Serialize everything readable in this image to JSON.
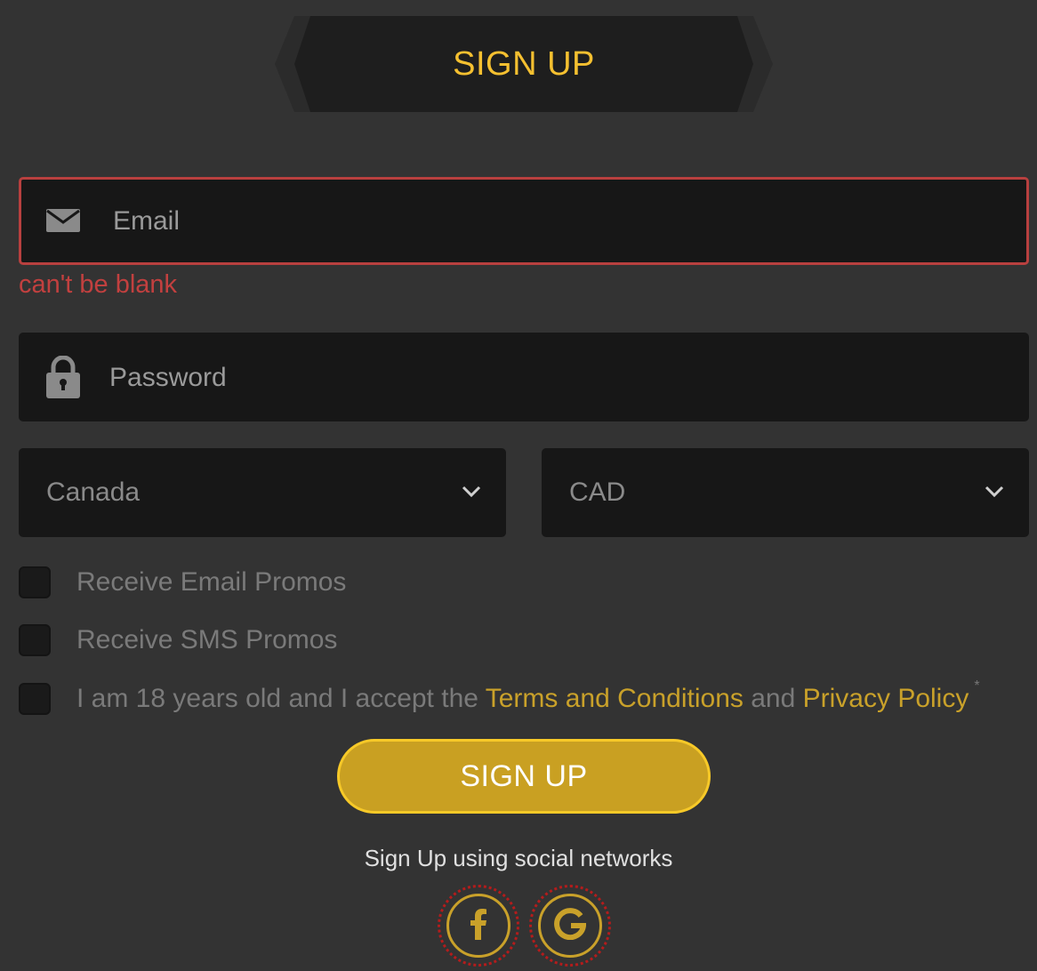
{
  "header": {
    "title": "SIGN UP"
  },
  "form": {
    "email": {
      "placeholder": "Email",
      "value": "",
      "icon": "envelope-icon",
      "error": "can't be blank"
    },
    "password": {
      "placeholder": "Password",
      "value": "",
      "icon": "lock-icon"
    },
    "country": {
      "selected": "Canada"
    },
    "currency": {
      "selected": "CAD"
    },
    "checkboxes": {
      "email_promos": {
        "label": "Receive Email Promos",
        "checked": false
      },
      "sms_promos": {
        "label": "Receive SMS Promos",
        "checked": false
      },
      "terms": {
        "prefix": "I am 18 years old and I accept the",
        "terms_link": "Terms and Conditions",
        "and": "and",
        "privacy_link": "Privacy Policy",
        "required_marker": "*",
        "checked": false
      }
    },
    "submit_label": "SIGN UP"
  },
  "social": {
    "caption": "Sign Up using social networks",
    "buttons": [
      {
        "name": "facebook",
        "icon": "facebook-icon"
      },
      {
        "name": "google",
        "icon": "google-icon"
      }
    ]
  },
  "colors": {
    "background": "#333333",
    "field_bg": "#171717",
    "accent_gold": "#f5c030",
    "button_gold": "#c9a022",
    "error_red": "#c2403f"
  }
}
